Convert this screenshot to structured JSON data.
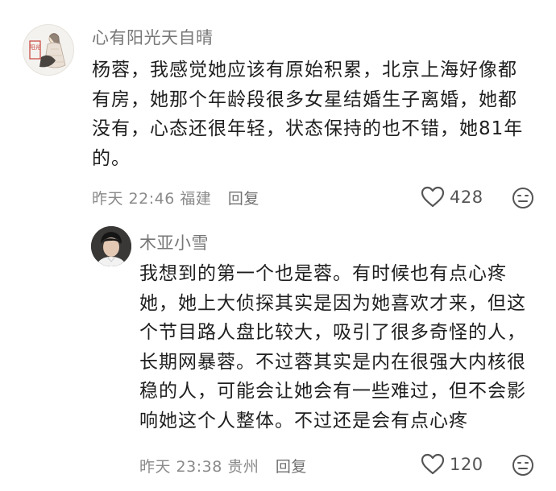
{
  "comments": [
    {
      "username": "心有阳光天自晴",
      "avatar_icon": "user-avatar-illustration",
      "avatar_seal_text": "阳光",
      "body_lines": [
        "杨蓉，我感觉她应该有原始积累，北京上海好像都",
        "有房，她那个年龄段很多女星结婚生子离婚，她都",
        "没有，心态还很年轻，状态保持的也不错，她81年",
        "的。"
      ],
      "timestamp": "昨天 22:46",
      "location": "福建",
      "reply_label": "回复",
      "like_count": "428",
      "like_icon": "heart-outline-icon",
      "reaction_icon": "emoji-face-icon"
    },
    {
      "username": "木亚小雪",
      "avatar_icon": "user-avatar-photo",
      "body_lines": [
        "我想到的第一个也是蓉。有时候也有点心疼",
        "她，她上大侦探其实是因为她喜欢才来，但这",
        "个节目路人盘比较大，吸引了很多奇怪的人，",
        "长期网暴蓉。不过蓉其实是内在很强大内核很",
        "稳的人，可能会让她会有一些难过，但不会影",
        "响她这个人整体。不过还是会有点心疼"
      ],
      "timestamp": "昨天 23:38",
      "location": "贵州",
      "reply_label": "回复",
      "like_count": "120",
      "like_icon": "heart-outline-icon",
      "reaction_icon": "emoji-face-icon"
    }
  ],
  "colors": {
    "username": "#777777",
    "body_text": "#1f1f1f",
    "meta_text": "#8a8a8a",
    "icon_stroke": "#555555",
    "seal_red": "#c8423a"
  }
}
